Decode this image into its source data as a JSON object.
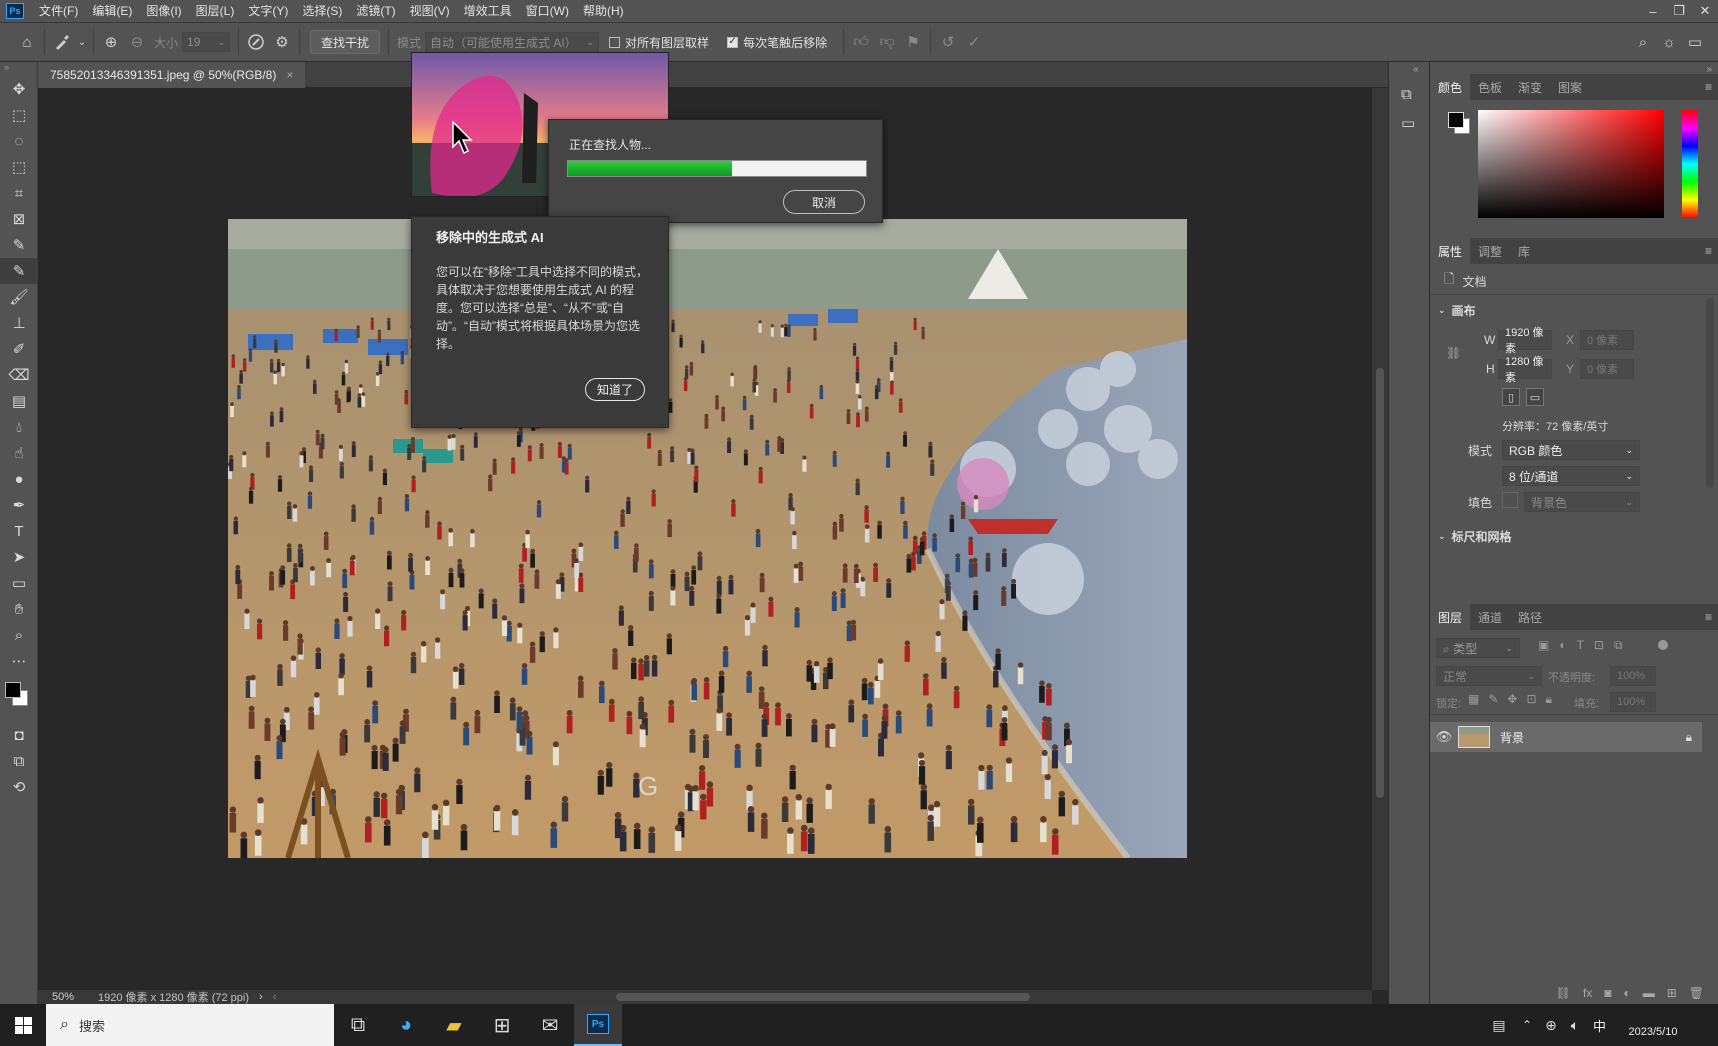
{
  "app": {
    "logo_text": "Ps",
    "menu": [
      "文件(F)",
      "编辑(E)",
      "图像(I)",
      "图层(L)",
      "文字(Y)",
      "选择(S)",
      "滤镜(T)",
      "视图(V)",
      "增效工具",
      "窗口(W)",
      "帮助(H)"
    ]
  },
  "options_bar": {
    "size_label": "大小",
    "size_value": "19",
    "find_button": "查找干扰",
    "mode_label": "模式",
    "mode_value": "自动（可能使用生成式 AI）",
    "sample_all_label": "对所有图层取样",
    "remove_after_stroke_label": "每次笔触后移除",
    "sample_all_checked": false,
    "remove_after_stroke_checked": true
  },
  "document": {
    "tab_title": "75852013346391351.jpeg @ 50%(RGB/8)",
    "close": "×"
  },
  "progress_dialog": {
    "message": "正在查找人物...",
    "progress": 0.55,
    "cancel_label": "取消"
  },
  "tip": {
    "title": "移除中的生成式 AI",
    "body": "您可以在“移除”工具中选择不同的模式，具体取决于您想要使用生成式 AI 的程度。您可以选择“总是”、“从不”或“自动”。“自动”模式将根据具体场景为您选择。",
    "ok_label": "知道了"
  },
  "status": {
    "zoom": "50%",
    "info": "1920 像素 x 1280 像素 (72 ppi)"
  },
  "color_panel": {
    "tabs": [
      "颜色",
      "色板",
      "渐变",
      "图案"
    ]
  },
  "properties_panel": {
    "tabs": [
      "属性",
      "调整",
      "库"
    ],
    "doc_label": "文档",
    "canvas_section": "画布",
    "w_label": "W",
    "w_value": "1920 像素",
    "h_label": "H",
    "h_value": "1280 像素",
    "x_label": "X",
    "x_placeholder": "0 像素",
    "y_label": "Y",
    "y_placeholder": "0 像素",
    "resolution": "分辨率：72 像素/英寸",
    "mode_label": "模式",
    "mode_value": "RGB 颜色",
    "depth_value": "8 位/通道",
    "fill_label": "填色",
    "fill_value": "背景色",
    "rulers_section": "标尺和网格"
  },
  "layers_panel": {
    "tabs": [
      "图层",
      "通道",
      "路径"
    ],
    "search_placeholder": "类型",
    "blend_mode": "正常",
    "opacity_label": "不透明度:",
    "opacity_value": "100%",
    "lock_label": "锁定:",
    "fill_label": "填充:",
    "fill_value": "100%",
    "layers": [
      {
        "name": "背景"
      }
    ]
  },
  "taskbar": {
    "search_placeholder": "搜索",
    "ime": "中",
    "clock_date": "2023/5/10"
  }
}
